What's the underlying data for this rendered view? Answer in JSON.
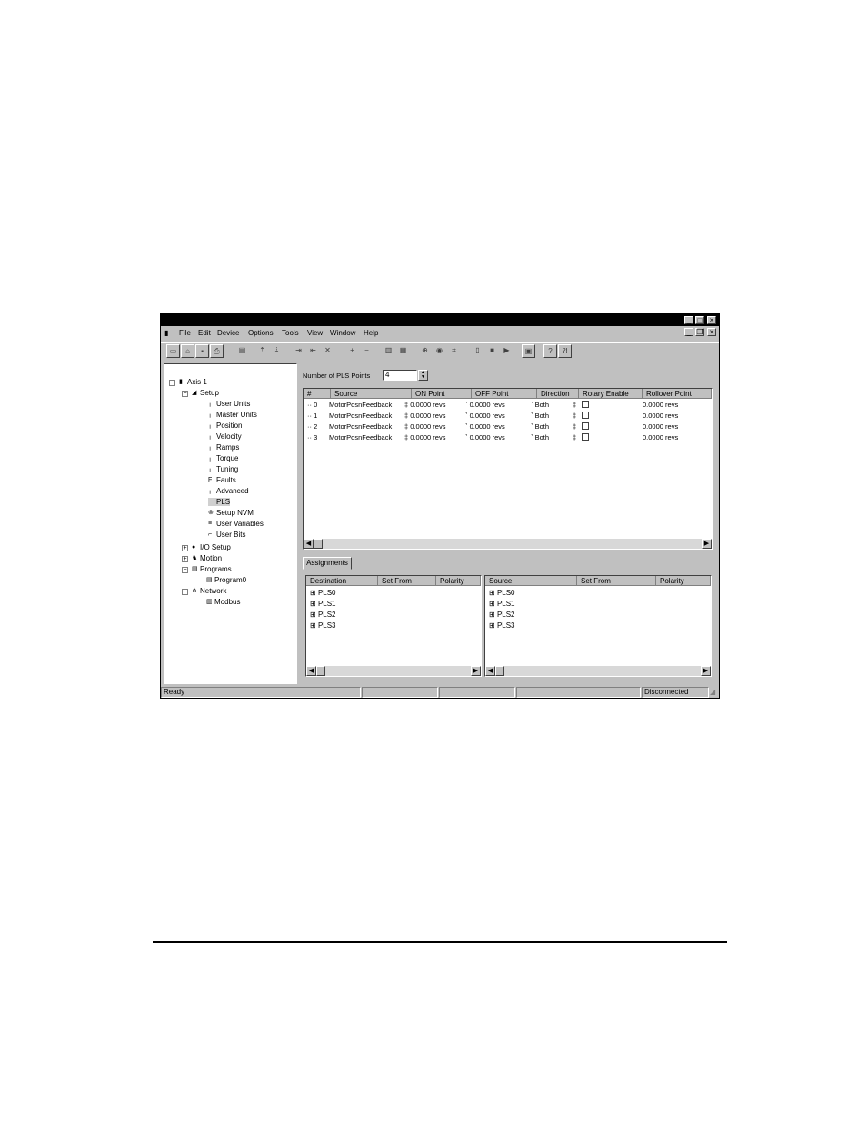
{
  "menu": [
    "File",
    "Edit",
    "Device",
    "Options",
    "Tools",
    "View",
    "Window",
    "Help"
  ],
  "tree": {
    "root": "Axis 1",
    "setup": "Setup",
    "setup_children": [
      "User Units",
      "Master Units",
      "Position",
      "Velocity",
      "Ramps",
      "Torque",
      "Tuning",
      "Faults",
      "Advanced",
      "PLS",
      "Setup NVM",
      "User Variables",
      "User Bits"
    ],
    "io_setup": "I/O Setup",
    "motion": "Motion",
    "programs": "Programs",
    "program0": "Program0",
    "network": "Network",
    "modbus": "Modbus"
  },
  "pls": {
    "count_label": "Number of PLS Points",
    "count_value": "4",
    "columns": [
      "#",
      "Source",
      "ON Point",
      "OFF Point",
      "Direction",
      "Rotary Enable",
      "Rollover Point"
    ],
    "rows": [
      {
        "n": "0",
        "source": "MotorPosnFeedback",
        "on": "0.0000 revs",
        "off": "0.0000 revs",
        "dir": "Both",
        "roll": "0.0000 revs"
      },
      {
        "n": "1",
        "source": "MotorPosnFeedback",
        "on": "0.0000 revs",
        "off": "0.0000 revs",
        "dir": "Both",
        "roll": "0.0000 revs"
      },
      {
        "n": "2",
        "source": "MotorPosnFeedback",
        "on": "0.0000 revs",
        "off": "0.0000 revs",
        "dir": "Both",
        "roll": "0.0000 revs"
      },
      {
        "n": "3",
        "source": "MotorPosnFeedback",
        "on": "0.0000 revs",
        "off": "0.0000 revs",
        "dir": "Both",
        "roll": "0.0000 revs"
      }
    ]
  },
  "assignments": {
    "tab": "Assignments",
    "left_columns": [
      "Destination",
      "Set From",
      "Polarity"
    ],
    "right_columns": [
      "Source",
      "Set From",
      "Polarity"
    ],
    "left_items": [
      "PLS0",
      "PLS1",
      "PLS2",
      "PLS3"
    ],
    "right_items": [
      "PLS0",
      "PLS1",
      "PLS2",
      "PLS3"
    ]
  },
  "status": {
    "left": "Ready",
    "right": "Disconnected"
  }
}
